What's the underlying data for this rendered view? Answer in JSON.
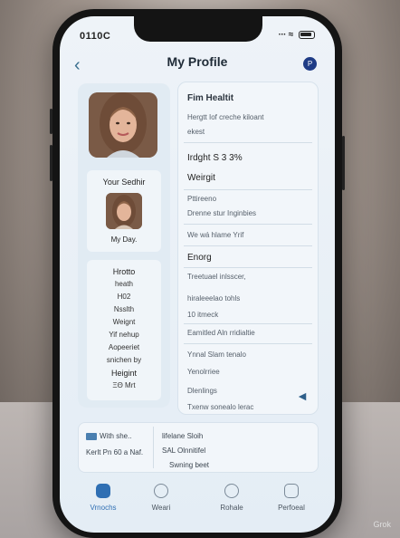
{
  "status": {
    "time": "0110C",
    "signal": "∙∙∙ ≈"
  },
  "header": {
    "title": "My Profile",
    "avatar_initial": "P"
  },
  "left": {
    "sub_title": "Your Sedhir",
    "sub_label": "My Day.",
    "list": [
      "Hrotto",
      "heath",
      "H02",
      "Nsslth",
      "Weignt",
      "Yif nehup",
      "Aopeeriet",
      "snichen by",
      "Heigint",
      "ΞΘ Mrt"
    ]
  },
  "right": {
    "title": "Fim Healtit",
    "line1": "Hergtt   Iof creche kiloant",
    "line2": "ekest",
    "height": "Irdght   S 3 3%",
    "weight": "Weirgit",
    "section1": "Pttireeno",
    "line3": "Drenne stur Inginbies",
    "line4": "We wá hlame Yrif",
    "energy": "Enorg",
    "line5": "Treetuael inlsscer,",
    "line6": "hiraleeelao tohls",
    "line7": "10 itmeck",
    "line8": "Eamitled Aln rridialtie",
    "line9": "Ynnal Slam tenalo",
    "line10": "Yenolrriee",
    "line11": "Dlenlings",
    "line12": "Txenw sonealo lerac"
  },
  "info": {
    "a1": "With she..",
    "a2": "Kerlt Pn 60 a Naf.",
    "b1": "lifelane Sloih",
    "b2": "SAL Olnnitifel",
    "b3": "Swning beet"
  },
  "tabs": [
    {
      "label": "Vrnochs",
      "icon": "home-icon"
    },
    {
      "label": "Weari",
      "icon": "heart-icon"
    },
    {
      "label": "Rohale",
      "icon": "settings-icon"
    },
    {
      "label": "Perfoeal",
      "icon": "profile-icon"
    }
  ],
  "watermark": "Grok",
  "colors": {
    "accent": "#2f6fb3",
    "screen_bg": "#eef3f8",
    "frame": "#141414"
  }
}
